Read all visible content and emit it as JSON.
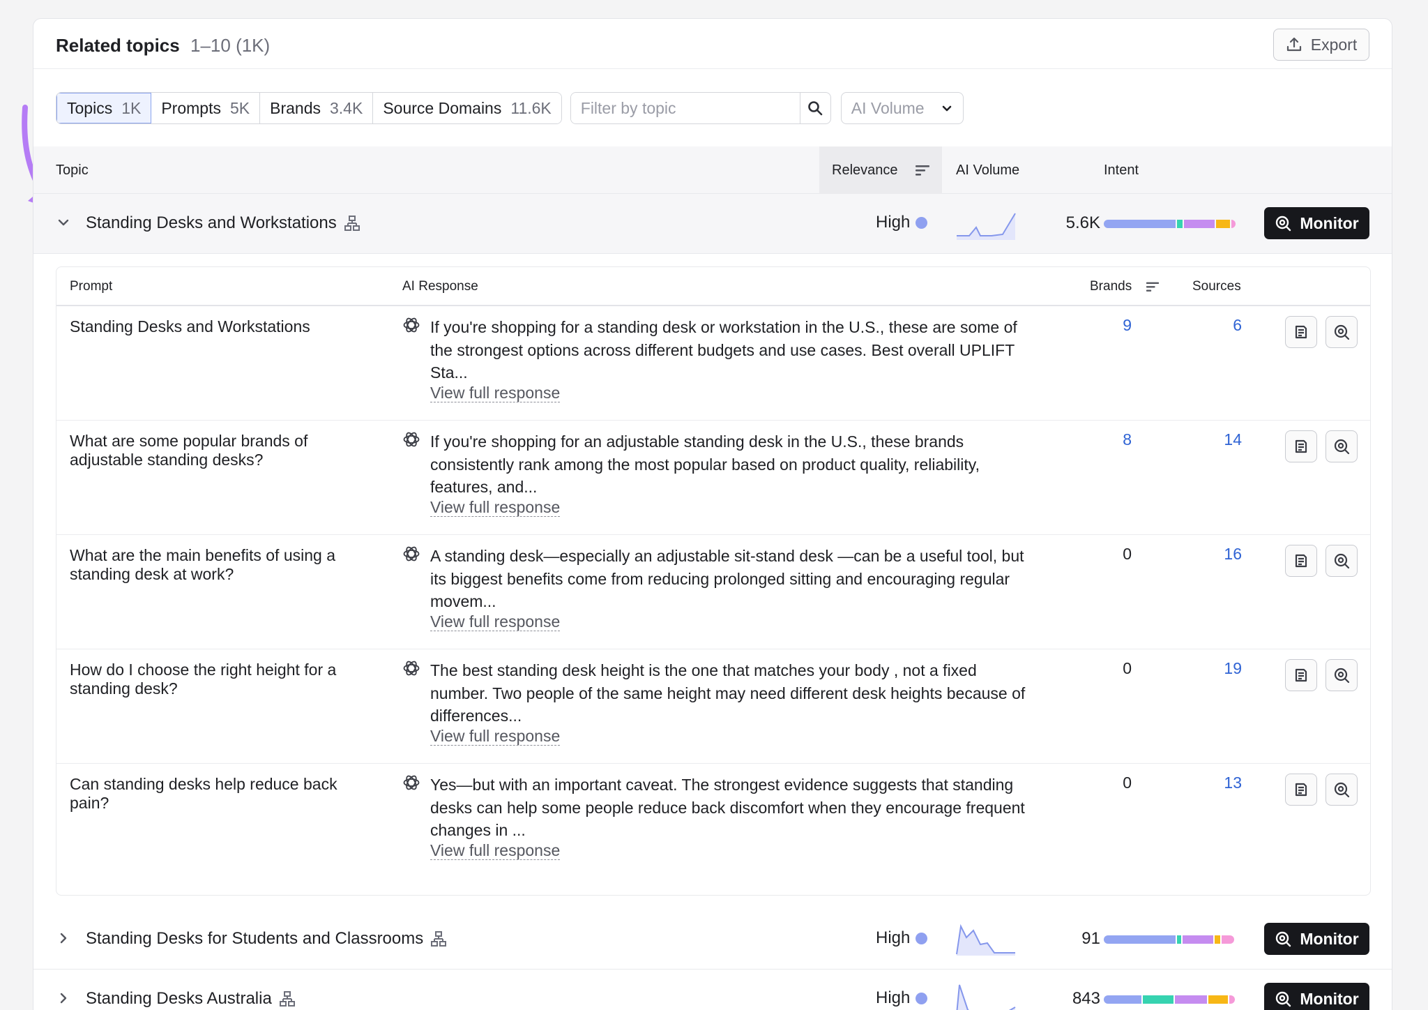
{
  "header": {
    "title": "Related topics",
    "range": "1–10 (1K)",
    "export_label": "Export"
  },
  "tabs": [
    {
      "label": "Topics",
      "count": "1K"
    },
    {
      "label": "Prompts",
      "count": "5K"
    },
    {
      "label": "Brands",
      "count": "3.4K"
    },
    {
      "label": "Source Domains",
      "count": "11.6K"
    }
  ],
  "filter": {
    "placeholder": "Filter by topic"
  },
  "dropdown": {
    "label": "AI Volume"
  },
  "columns": {
    "topic": "Topic",
    "relevance": "Relevance",
    "ai_volume": "AI Volume",
    "intent": "Intent"
  },
  "topics": [
    {
      "name": "Standing Desks and Workstations",
      "relevance": "High",
      "volume": "5.6K",
      "monitor": "Monitor"
    },
    {
      "name": "Standing Desks for Students and Classrooms",
      "relevance": "High",
      "volume": "91",
      "monitor": "Monitor"
    },
    {
      "name": "Standing Desks Australia",
      "relevance": "High",
      "volume": "843",
      "monitor": "Monitor"
    }
  ],
  "subtable": {
    "columns": {
      "prompt": "Prompt",
      "response": "AI Response",
      "brands": "Brands",
      "sources": "Sources"
    },
    "view_label": "View full response",
    "rows": [
      {
        "prompt": "Standing Desks and Workstations",
        "response": "If you're shopping for a standing desk or workstation in the U.S., these are some of the strongest options across different budgets and use cases. Best overall UPLIFT Sta...",
        "brands": "9",
        "sources": "6"
      },
      {
        "prompt": "What are some popular brands of adjustable standing desks?",
        "response": "If you're shopping for an adjustable standing desk in the U.S., these brands consistently rank among the most popular based on product quality, reliability, features, and...",
        "brands": "8",
        "sources": "14"
      },
      {
        "prompt": "What are the main benefits of using a standing desk at work?",
        "response": "A standing desk—especially an adjustable sit-stand desk —can be a useful tool, but its biggest benefits come from reducing prolonged sitting and encouraging regular movem...",
        "brands": "0",
        "sources": "16"
      },
      {
        "prompt": "How do I choose the right height for a standing desk?",
        "response": "The best standing desk height is the one that matches your body , not a fixed number. Two people of the same height may need different desk heights because of differences...",
        "brands": "0",
        "sources": "19"
      },
      {
        "prompt": "Can standing desks help reduce back pain?",
        "response": "Yes—but with an important caveat. The strongest evidence suggests that standing desks can help some people reduce back discomfort when they encourage frequent changes in ...",
        "brands": "0",
        "sources": "13"
      }
    ]
  },
  "colors": {
    "accent_blue": "#2f63d4",
    "relevance_dot": "#8fa0f0",
    "arrow": "#b57cf5",
    "intent": [
      "#93a5f2",
      "#36d3b0",
      "#c58cf0",
      "#f7b716",
      "#f59ad9"
    ]
  }
}
